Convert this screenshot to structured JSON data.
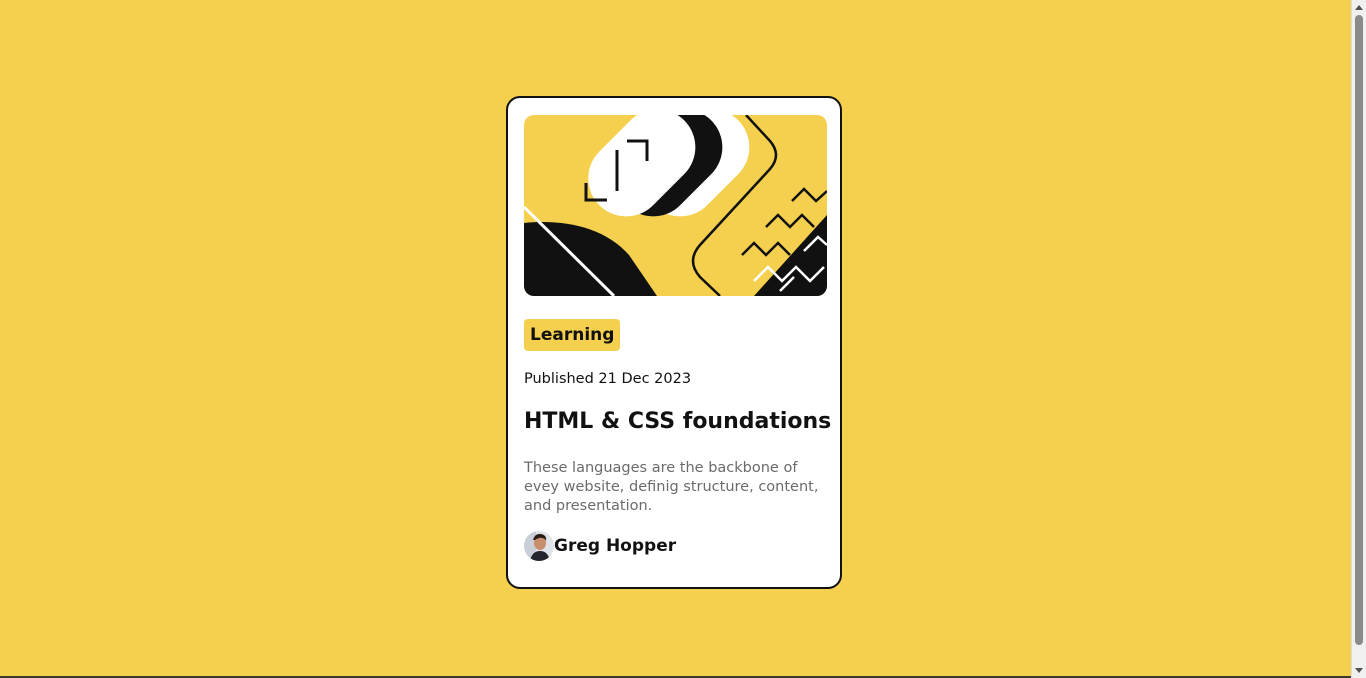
{
  "card": {
    "hero_illustration": "abstract-yellow-illustration",
    "tag": "Learning",
    "published": "Published 21 Dec 2023",
    "title": "HTML & CSS foundations",
    "description": "These languages are the backbone of evey website, definig structure, content, and presentation.",
    "author": {
      "name": "Greg Hopper",
      "avatar": "avatar-photo"
    }
  },
  "colors": {
    "background": "#f4d04e",
    "card": "#ffffff",
    "ink": "#111111",
    "muted": "#6b6b6b"
  }
}
